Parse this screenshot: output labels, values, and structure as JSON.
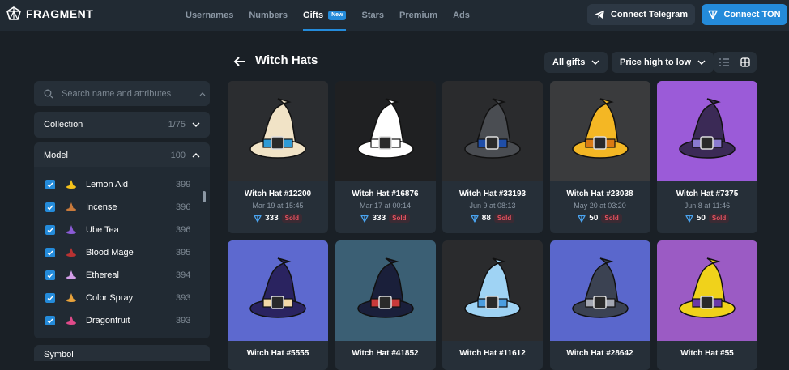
{
  "header": {
    "logo_text": "FRAGMENT",
    "nav": [
      {
        "label": "Usernames"
      },
      {
        "label": "Numbers"
      },
      {
        "label": "Gifts",
        "badge": "New"
      },
      {
        "label": "Stars"
      },
      {
        "label": "Premium"
      },
      {
        "label": "Ads"
      }
    ],
    "connect_telegram": "Connect Telegram",
    "connect_ton": "Connect TON"
  },
  "sidebar": {
    "search_placeholder": "Search name and attributes",
    "collection": {
      "label": "Collection",
      "count": "1/75"
    },
    "model": {
      "label": "Model",
      "count": "100"
    },
    "models": [
      {
        "name": "Lemon Aid",
        "count": "399",
        "color": "#f5c21b"
      },
      {
        "name": "Incense",
        "count": "396",
        "color": "#c97a3b"
      },
      {
        "name": "Ube Tea",
        "count": "396",
        "color": "#8b5bd6"
      },
      {
        "name": "Blood Mage",
        "count": "395",
        "color": "#b83232"
      },
      {
        "name": "Ethereal",
        "count": "394",
        "color": "#d39ee8"
      },
      {
        "name": "Color Spray",
        "count": "393",
        "color": "#e8a23b"
      },
      {
        "name": "Dragonfruit",
        "count": "393",
        "color": "#e04a8a"
      }
    ],
    "next_section": "Symbol"
  },
  "main": {
    "title": "Witch Hats",
    "filter_all": "All gifts",
    "sort": "Price high to low",
    "cards": [
      {
        "name": "Witch Hat #12200",
        "date": "Mar 19 at 15:45",
        "price": "333",
        "sold": "Sold",
        "bg": "#2b2d30",
        "hat": "#f1e3c6",
        "band": "#2f9bd6"
      },
      {
        "name": "Witch Hat #16876",
        "date": "Mar 17 at 00:14",
        "price": "333",
        "sold": "Sold",
        "bg": "#1f2022",
        "hat": "#ffffff",
        "band": "#ffffff"
      },
      {
        "name": "Witch Hat #33193",
        "date": "Jun 9 at 08:13",
        "price": "88",
        "sold": "Sold",
        "bg": "#2a2b2d",
        "hat": "#4a4d52",
        "band": "#1f4ea8"
      },
      {
        "name": "Witch Hat #23038",
        "date": "May 20 at 03:20",
        "price": "50",
        "sold": "Sold",
        "bg": "#3a3b3d",
        "hat": "#f4b724",
        "band": "#d97a14"
      },
      {
        "name": "Witch Hat #7375",
        "date": "Jun 8 at 11:46",
        "price": "50",
        "sold": "Sold",
        "bg": "#9b5bd8",
        "hat": "#3b2a56",
        "band": "#8a7ad0"
      },
      {
        "name": "Witch Hat #5555",
        "bg": "#5d69cf",
        "hat": "#2a2360",
        "band": "#f3d9a8"
      },
      {
        "name": "Witch Hat #41852",
        "bg": "#3b5f74",
        "hat": "#1a1f3a",
        "band": "#c83a3a"
      },
      {
        "name": "Witch Hat #11612",
        "bg": "#2a2b2d",
        "hat": "#9fd3f4",
        "band": "#4b9de0"
      },
      {
        "name": "Witch Hat #28642",
        "bg": "#5a67cc",
        "hat": "#3b4252",
        "band": "#a3a7b2"
      },
      {
        "name": "Witch Hat #55",
        "bg": "#9b5bc4",
        "hat": "#f0d21b",
        "band": "#6a3aa8"
      }
    ]
  }
}
